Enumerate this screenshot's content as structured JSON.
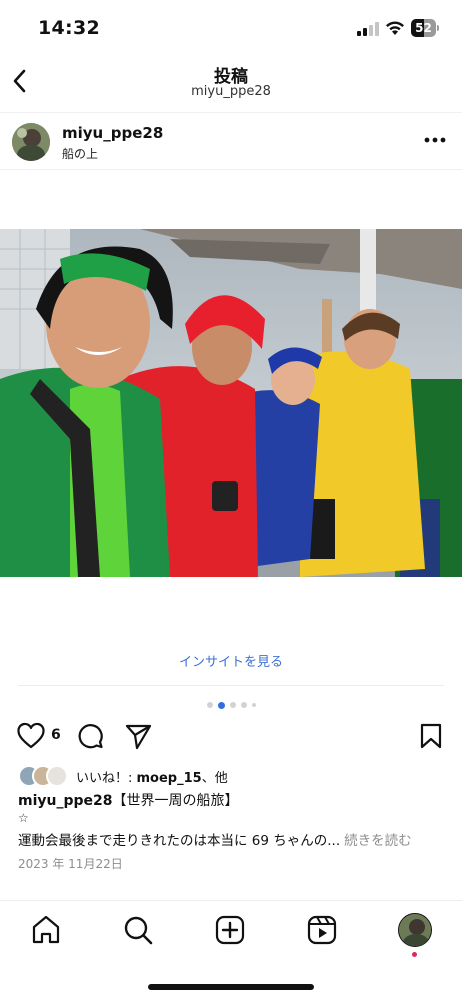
{
  "status_bar": {
    "time": "14:32",
    "battery": "52",
    "battery_level": 0.52
  },
  "header": {
    "title": "投稿",
    "subtitle": "miyu_ppe28"
  },
  "post": {
    "username": "miyu_ppe28",
    "location": "船の上",
    "insights_link": "インサイトを見る",
    "carousel": {
      "count": 5,
      "active_index": 1
    },
    "like_count": "6",
    "likes_prefix": "いいね！: ",
    "likes_user": "moep_15",
    "likes_suffix": "、他",
    "caption_user": "miyu_ppe28",
    "caption_title": "【世界一周の船旅】",
    "caption_star": "☆",
    "caption_text": "運動会最後まで走りきれたのは本当に 69 ちゃんの...",
    "caption_more": "続きを読む",
    "date": "2023 年 11月22日"
  },
  "icons": {
    "back": "chevron-left-icon",
    "more": "ellipsis-icon",
    "like": "heart-icon",
    "comment": "comment-bubble-icon",
    "share": "paper-plane-icon",
    "save": "bookmark-icon",
    "home": "home-icon",
    "search": "search-icon",
    "create": "plus-square-icon",
    "reels": "reels-icon"
  },
  "colors": {
    "link": "#3b6fd6",
    "active_dot": "#2f6fe0",
    "notification": "#e0245e"
  }
}
